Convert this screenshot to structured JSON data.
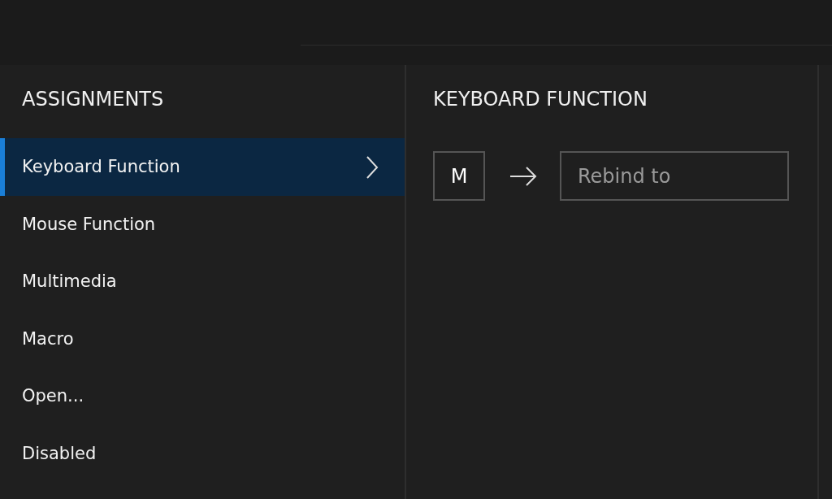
{
  "assignments": {
    "title": "ASSIGNMENTS",
    "items": [
      {
        "label": "Keyboard Function",
        "selected": true
      },
      {
        "label": "Mouse Function",
        "selected": false
      },
      {
        "label": "Multimedia",
        "selected": false
      },
      {
        "label": "Macro",
        "selected": false
      },
      {
        "label": "Open...",
        "selected": false
      },
      {
        "label": "Disabled",
        "selected": false
      }
    ]
  },
  "keyboard_function": {
    "title": "KEYBOARD FUNCTION",
    "key": "M",
    "rebind": {
      "placeholder": "Rebind to"
    }
  }
}
